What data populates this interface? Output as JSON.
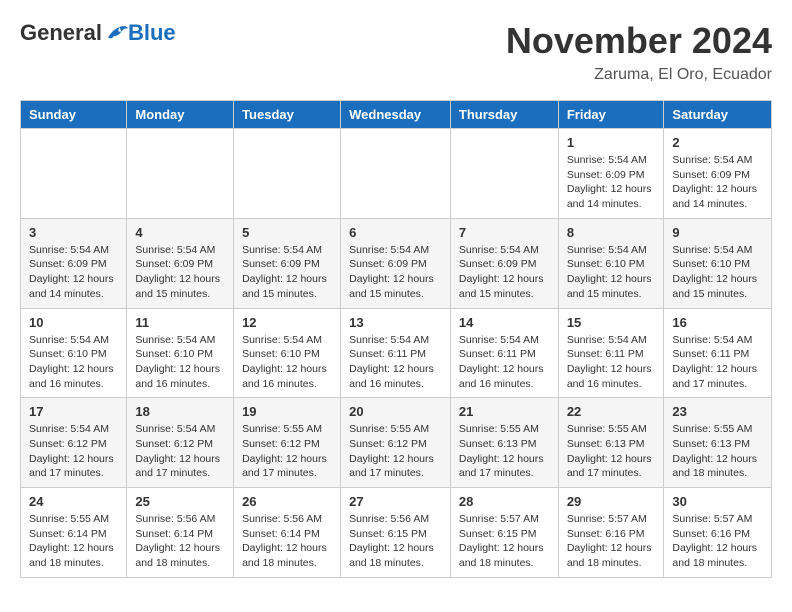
{
  "header": {
    "logo_general": "General",
    "logo_blue": "Blue",
    "month_title": "November 2024",
    "location": "Zaruma, El Oro, Ecuador"
  },
  "weekdays": [
    "Sunday",
    "Monday",
    "Tuesday",
    "Wednesday",
    "Thursday",
    "Friday",
    "Saturday"
  ],
  "weeks": [
    [
      {
        "day": "",
        "info": ""
      },
      {
        "day": "",
        "info": ""
      },
      {
        "day": "",
        "info": ""
      },
      {
        "day": "",
        "info": ""
      },
      {
        "day": "",
        "info": ""
      },
      {
        "day": "1",
        "info": "Sunrise: 5:54 AM\nSunset: 6:09 PM\nDaylight: 12 hours and 14 minutes."
      },
      {
        "day": "2",
        "info": "Sunrise: 5:54 AM\nSunset: 6:09 PM\nDaylight: 12 hours and 14 minutes."
      }
    ],
    [
      {
        "day": "3",
        "info": "Sunrise: 5:54 AM\nSunset: 6:09 PM\nDaylight: 12 hours and 14 minutes."
      },
      {
        "day": "4",
        "info": "Sunrise: 5:54 AM\nSunset: 6:09 PM\nDaylight: 12 hours and 15 minutes."
      },
      {
        "day": "5",
        "info": "Sunrise: 5:54 AM\nSunset: 6:09 PM\nDaylight: 12 hours and 15 minutes."
      },
      {
        "day": "6",
        "info": "Sunrise: 5:54 AM\nSunset: 6:09 PM\nDaylight: 12 hours and 15 minutes."
      },
      {
        "day": "7",
        "info": "Sunrise: 5:54 AM\nSunset: 6:09 PM\nDaylight: 12 hours and 15 minutes."
      },
      {
        "day": "8",
        "info": "Sunrise: 5:54 AM\nSunset: 6:10 PM\nDaylight: 12 hours and 15 minutes."
      },
      {
        "day": "9",
        "info": "Sunrise: 5:54 AM\nSunset: 6:10 PM\nDaylight: 12 hours and 15 minutes."
      }
    ],
    [
      {
        "day": "10",
        "info": "Sunrise: 5:54 AM\nSunset: 6:10 PM\nDaylight: 12 hours and 16 minutes."
      },
      {
        "day": "11",
        "info": "Sunrise: 5:54 AM\nSunset: 6:10 PM\nDaylight: 12 hours and 16 minutes."
      },
      {
        "day": "12",
        "info": "Sunrise: 5:54 AM\nSunset: 6:10 PM\nDaylight: 12 hours and 16 minutes."
      },
      {
        "day": "13",
        "info": "Sunrise: 5:54 AM\nSunset: 6:11 PM\nDaylight: 12 hours and 16 minutes."
      },
      {
        "day": "14",
        "info": "Sunrise: 5:54 AM\nSunset: 6:11 PM\nDaylight: 12 hours and 16 minutes."
      },
      {
        "day": "15",
        "info": "Sunrise: 5:54 AM\nSunset: 6:11 PM\nDaylight: 12 hours and 16 minutes."
      },
      {
        "day": "16",
        "info": "Sunrise: 5:54 AM\nSunset: 6:11 PM\nDaylight: 12 hours and 17 minutes."
      }
    ],
    [
      {
        "day": "17",
        "info": "Sunrise: 5:54 AM\nSunset: 6:12 PM\nDaylight: 12 hours and 17 minutes."
      },
      {
        "day": "18",
        "info": "Sunrise: 5:54 AM\nSunset: 6:12 PM\nDaylight: 12 hours and 17 minutes."
      },
      {
        "day": "19",
        "info": "Sunrise: 5:55 AM\nSunset: 6:12 PM\nDaylight: 12 hours and 17 minutes."
      },
      {
        "day": "20",
        "info": "Sunrise: 5:55 AM\nSunset: 6:12 PM\nDaylight: 12 hours and 17 minutes."
      },
      {
        "day": "21",
        "info": "Sunrise: 5:55 AM\nSunset: 6:13 PM\nDaylight: 12 hours and 17 minutes."
      },
      {
        "day": "22",
        "info": "Sunrise: 5:55 AM\nSunset: 6:13 PM\nDaylight: 12 hours and 17 minutes."
      },
      {
        "day": "23",
        "info": "Sunrise: 5:55 AM\nSunset: 6:13 PM\nDaylight: 12 hours and 18 minutes."
      }
    ],
    [
      {
        "day": "24",
        "info": "Sunrise: 5:55 AM\nSunset: 6:14 PM\nDaylight: 12 hours and 18 minutes."
      },
      {
        "day": "25",
        "info": "Sunrise: 5:56 AM\nSunset: 6:14 PM\nDaylight: 12 hours and 18 minutes."
      },
      {
        "day": "26",
        "info": "Sunrise: 5:56 AM\nSunset: 6:14 PM\nDaylight: 12 hours and 18 minutes."
      },
      {
        "day": "27",
        "info": "Sunrise: 5:56 AM\nSunset: 6:15 PM\nDaylight: 12 hours and 18 minutes."
      },
      {
        "day": "28",
        "info": "Sunrise: 5:57 AM\nSunset: 6:15 PM\nDaylight: 12 hours and 18 minutes."
      },
      {
        "day": "29",
        "info": "Sunrise: 5:57 AM\nSunset: 6:16 PM\nDaylight: 12 hours and 18 minutes."
      },
      {
        "day": "30",
        "info": "Sunrise: 5:57 AM\nSunset: 6:16 PM\nDaylight: 12 hours and 18 minutes."
      }
    ]
  ]
}
